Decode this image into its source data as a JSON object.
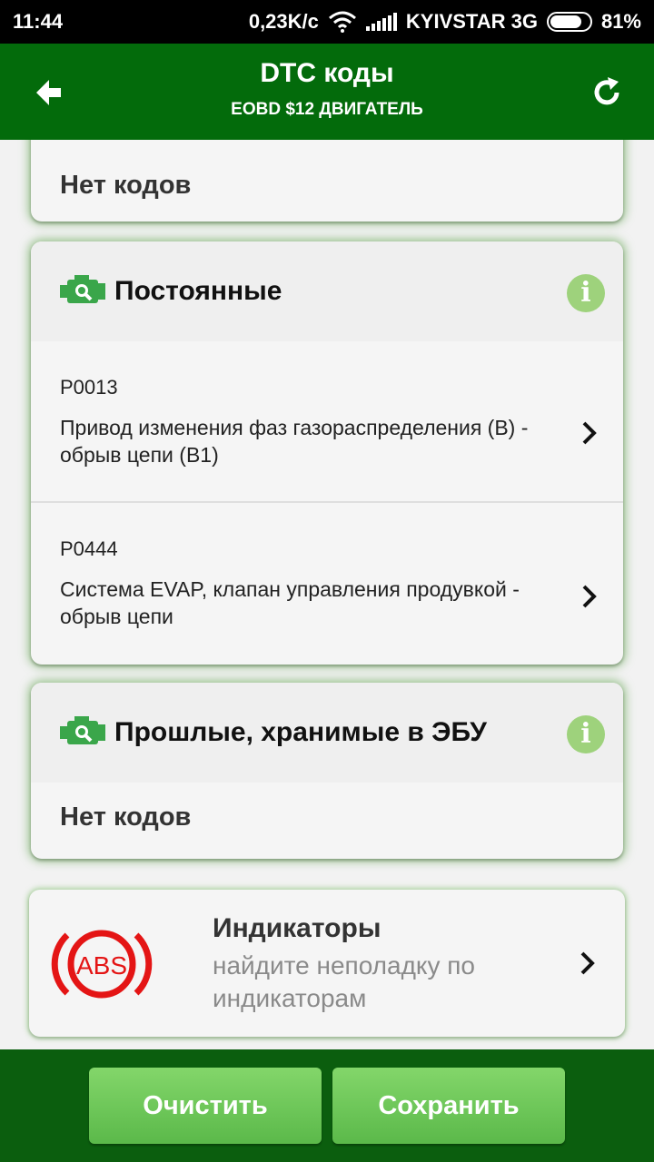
{
  "status_bar": {
    "time": "11:44",
    "speed": "0,23K/c",
    "carrier": "KYIVSTAR 3G",
    "battery": "81%",
    "battery_level": 0.81
  },
  "header": {
    "title": "DTC коды",
    "subtitle": "EOBD $12 ДВИГАТЕЛЬ",
    "back_icon": "arrow-left-icon",
    "refresh_icon": "refresh-icon"
  },
  "sections": {
    "top": {
      "empty_text": "Нет кодов"
    },
    "permanent": {
      "title": "Постоянные",
      "codes": [
        {
          "code": "P0013",
          "description": "Привод изменения фаз газораспределения (B) - обрыв цепи (B1)"
        },
        {
          "code": "P0444",
          "description": "Система EVAP, клапан управления продувкой - обрыв цепи"
        }
      ]
    },
    "past": {
      "title": "Прошлые, хранимые в ЭБУ",
      "empty_text": "Нет кодов"
    }
  },
  "indicators": {
    "title": "Индикаторы",
    "subtitle": "найдите неполадку по индикаторам",
    "badge_text": "ABS"
  },
  "buttons": {
    "clear": "Очистить",
    "save": "Сохранить"
  },
  "colors": {
    "app_bar": "#036b0b",
    "bottom_bar": "#0b5e0e",
    "button": "#6cc856",
    "engine_icon": "#3aa64a",
    "info_badge": "#9ed27c",
    "abs_red": "#e41515"
  }
}
